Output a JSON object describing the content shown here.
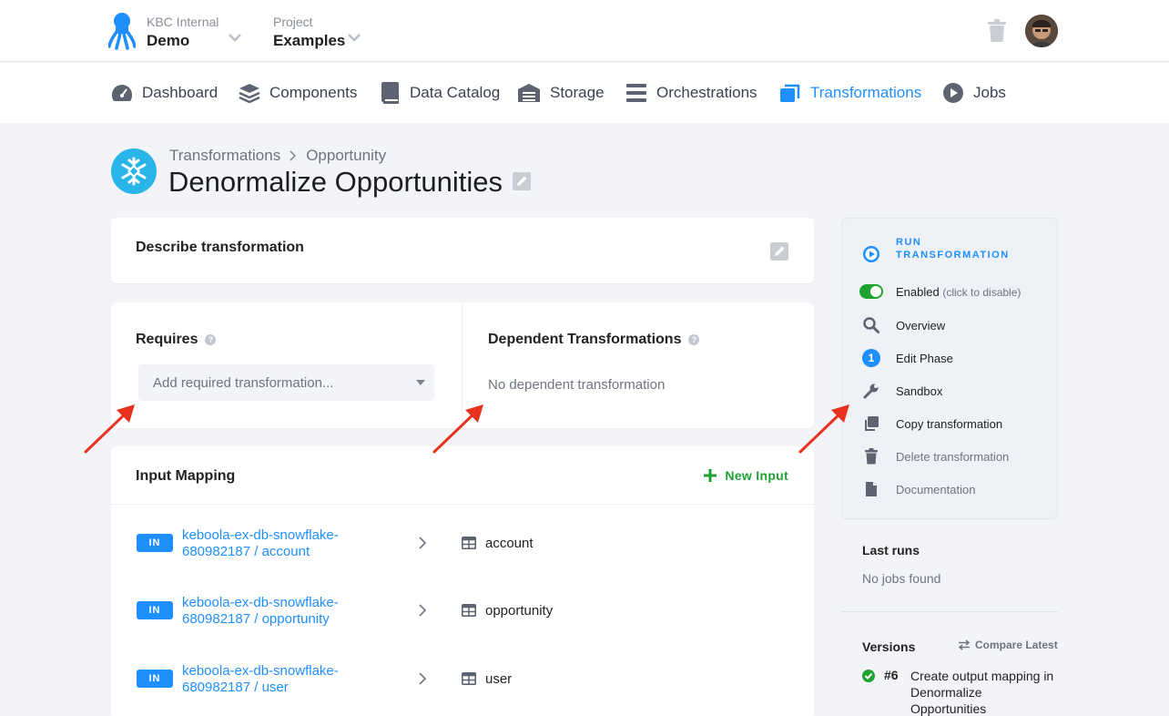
{
  "topbar": {
    "org_sub": "KBC Internal",
    "org_name": "Demo",
    "project_sub": "Project",
    "project_name": "Examples"
  },
  "nav": {
    "dashboard": "Dashboard",
    "components": "Components",
    "data_catalog": "Data Catalog",
    "storage": "Storage",
    "orchestrations": "Orchestrations",
    "transformations": "Transformations",
    "jobs": "Jobs",
    "active": "Transformations"
  },
  "header": {
    "breadcrumb_root": "Transformations",
    "breadcrumb_bucket": "Opportunity",
    "title": "Denormalize Opportunities"
  },
  "describe": {
    "label": "Describe transformation"
  },
  "requires": {
    "title": "Requires",
    "placeholder": "Add required transformation..."
  },
  "dependent": {
    "title": "Dependent Transformations",
    "empty": "No dependent transformation"
  },
  "input_mapping": {
    "title": "Input Mapping",
    "new_input": "New Input",
    "badge": "IN",
    "rows": [
      {
        "source_line1": "keboola-ex-db-snowflake-",
        "source_line2": "680982187 / account",
        "destination": "account"
      },
      {
        "source_line1": "keboola-ex-db-snowflake-",
        "source_line2": "680982187 / opportunity",
        "destination": "opportunity"
      },
      {
        "source_line1": "keboola-ex-db-snowflake-",
        "source_line2": "680982187 / user",
        "destination": "user"
      }
    ]
  },
  "sidebar": {
    "run_line1": "RUN",
    "run_line2": "TRANSFORMATION",
    "enabled": "Enabled",
    "enabled_hint": "(click to disable)",
    "overview": "Overview",
    "phase_number": "1",
    "edit_phase": "Edit Phase",
    "sandbox": "Sandbox",
    "copy": "Copy transformation",
    "delete": "Delete transformation",
    "documentation": "Documentation",
    "enabled_state": true
  },
  "last_runs": {
    "title": "Last runs",
    "empty": "No jobs found"
  },
  "versions": {
    "title": "Versions",
    "compare": "Compare Latest",
    "latest_number": "#6",
    "latest_desc": "Create output mapping in Denormalize Opportunities"
  },
  "colors": {
    "accent": "#1f8fff",
    "success": "#1fa232",
    "snowflake": "#29b5e8",
    "annotation_arrow": "#e8321e"
  }
}
